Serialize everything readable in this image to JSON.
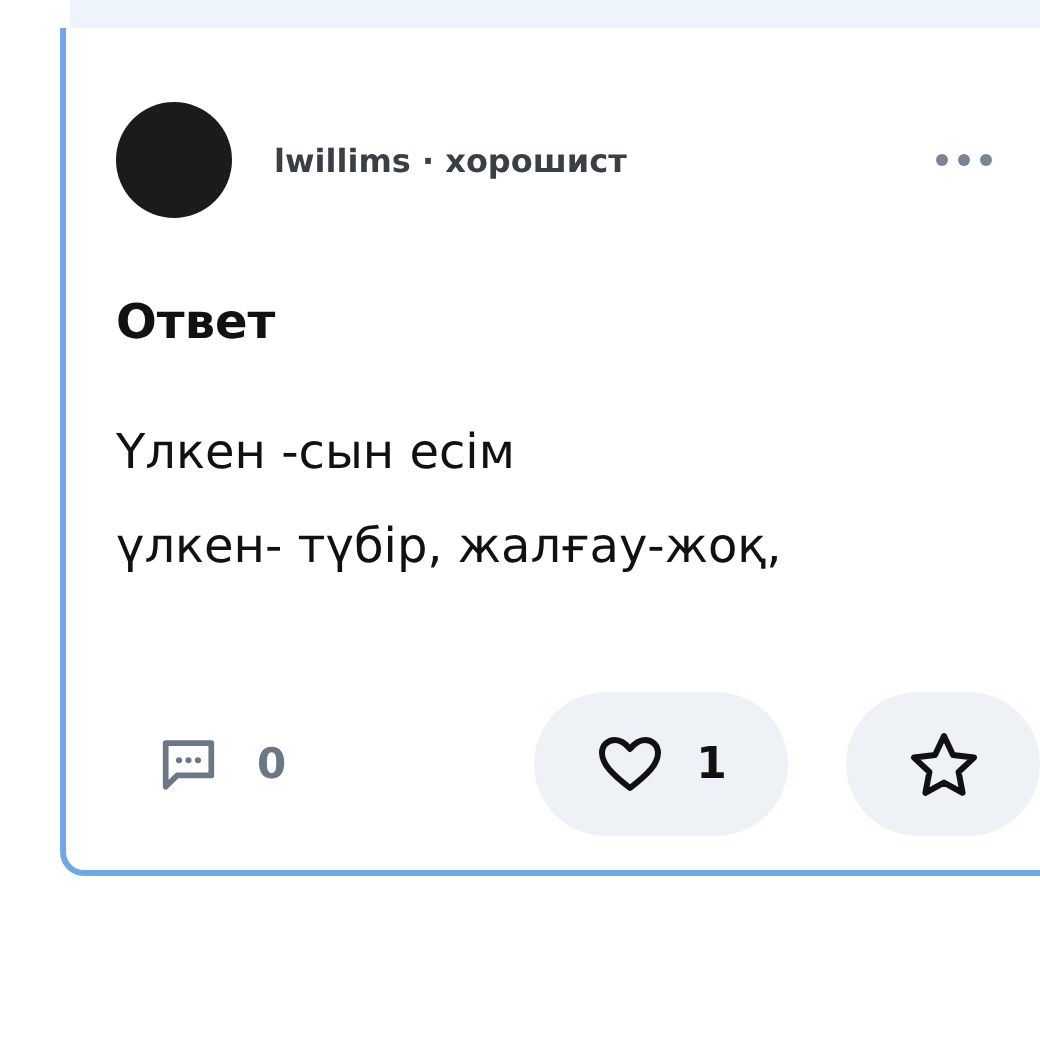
{
  "answer": {
    "byline": "lwillims · хорошист",
    "heading": "Ответ",
    "lines": [
      "Үлкен -сын есім",
      "үлкен- түбір, жалғау-жоқ,"
    ],
    "comments": "0",
    "likes": "1",
    "liked": false
  }
}
